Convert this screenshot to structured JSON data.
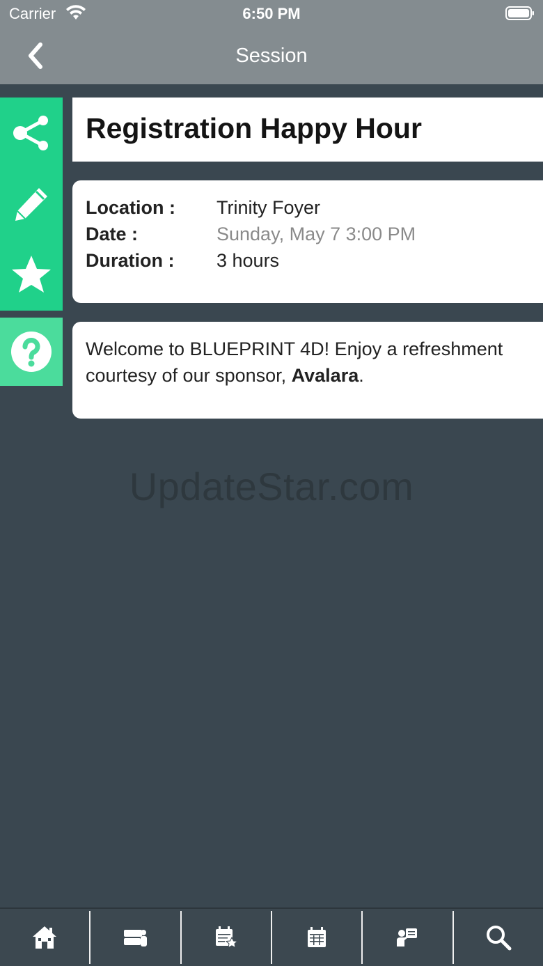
{
  "status_bar": {
    "carrier": "Carrier",
    "time": "6:50 PM"
  },
  "nav": {
    "title": "Session",
    "back_icon": "chevron-left-icon"
  },
  "side_actions": [
    {
      "name": "share",
      "icon": "share-icon"
    },
    {
      "name": "note",
      "icon": "pencil-icon"
    },
    {
      "name": "favorite",
      "icon": "star-icon"
    },
    {
      "name": "help",
      "icon": "question-icon"
    }
  ],
  "session": {
    "title": "Registration Happy Hour",
    "location_label": "Location :",
    "location": "Trinity Foyer",
    "date_label": "Date :",
    "date": "Sunday, May 7 3:00 PM",
    "duration_label": "Duration :",
    "duration": "3 hours",
    "description_prefix": "Welcome to BLUEPRINT 4D! Enjoy a refreshment courtesy of our sponsor, ",
    "description_sponsor": "Avalara",
    "description_suffix": "."
  },
  "watermark": "UpdateStar.com",
  "tabs": [
    {
      "name": "home",
      "icon": "home-icon"
    },
    {
      "name": "exhibitors",
      "icon": "booth-icon"
    },
    {
      "name": "my-schedule",
      "icon": "calendar-star-icon"
    },
    {
      "name": "schedule",
      "icon": "calendar-icon"
    },
    {
      "name": "speakers",
      "icon": "speaker-icon"
    },
    {
      "name": "search",
      "icon": "search-icon"
    }
  ],
  "colors": {
    "accent": "#20d18a",
    "help": "#4bdc9c",
    "bar": "#848c90",
    "background": "#3a4750"
  }
}
